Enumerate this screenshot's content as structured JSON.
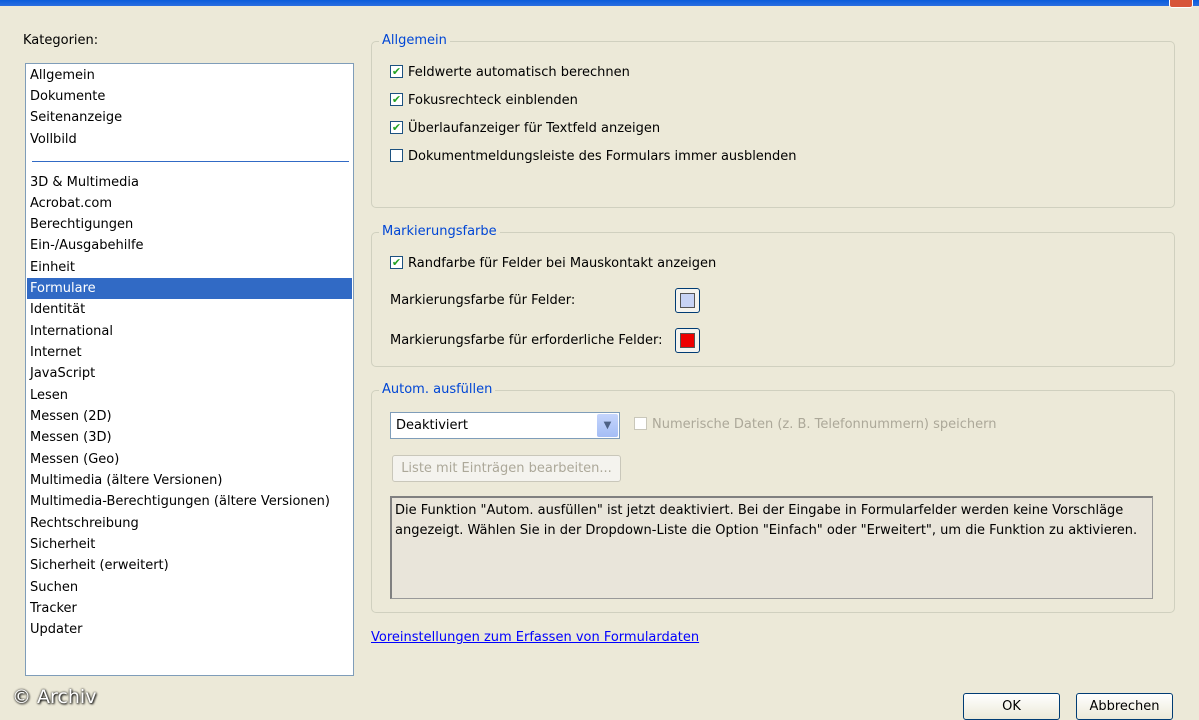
{
  "categories": {
    "label": "Kategorien:",
    "top_items": [
      "Allgemein",
      "Dokumente",
      "Seitenanzeige",
      "Vollbild"
    ],
    "items": [
      "3D & Multimedia",
      "Acrobat.com",
      "Berechtigungen",
      "Ein-/Ausgabehilfe",
      "Einheit",
      "Formulare",
      "Identität",
      "International",
      "Internet",
      "JavaScript",
      "Lesen",
      "Messen (2D)",
      "Messen (3D)",
      "Messen (Geo)",
      "Multimedia (ältere Versionen)",
      "Multimedia-Berechtigungen (ältere Versionen)",
      "Rechtschreibung",
      "Sicherheit",
      "Sicherheit (erweitert)",
      "Suchen",
      "Tracker",
      "Updater"
    ],
    "selected": "Formulare"
  },
  "allgemein": {
    "legend": "Allgemein",
    "options": [
      {
        "label": "Feldwerte automatisch berechnen",
        "checked": true
      },
      {
        "label": "Fokusrechteck einblenden",
        "checked": true
      },
      {
        "label": "Überlaufanzeiger für Textfeld anzeigen",
        "checked": true
      },
      {
        "label": "Dokumentmeldungsleiste des Formulars immer ausblenden",
        "checked": false
      }
    ]
  },
  "markierung": {
    "legend": "Markierungsfarbe",
    "hover_border": {
      "label": "Randfarbe für Felder bei Mauskontakt anzeigen",
      "checked": true
    },
    "field_color_label": "Markierungsfarbe für Felder:",
    "field_color": "#c7d3f5",
    "required_color_label": "Markierungsfarbe für erforderliche Felder:",
    "required_color": "#ee0000"
  },
  "autofill": {
    "legend": "Autom. ausfüllen",
    "mode": "Deaktiviert",
    "numeric_label": "Numerische Daten (z. B. Telefonnummern) speichern",
    "numeric_checked": false,
    "edit_button": "Liste mit Einträgen bearbeiten...",
    "description": "Die Funktion \"Autom. ausfüllen\" ist jetzt deaktiviert. Bei der Eingabe in Formularfelder werden keine Vorschläge angezeigt. Wählen Sie in der Dropdown-Liste die Option \"Einfach\" oder \"Erweitert\", um die Funktion zu aktivieren."
  },
  "link": "Voreinstellungen zum Erfassen von Formulardaten",
  "buttons": {
    "ok": "OK",
    "cancel": "Abbrechen"
  },
  "watermark": "© Archiv"
}
